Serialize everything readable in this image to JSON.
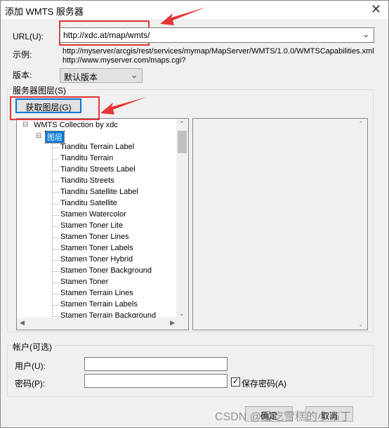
{
  "title": "添加 WMTS 服务器",
  "url": {
    "label": "URL(U):",
    "value": "http://xdc.at/map/wmts/"
  },
  "example": {
    "label": "示例:",
    "line1": "http://myserver/arcgis/rest/services/mymap/MapServer/WMTS/1.0.0/WMTSCapabilities.xml",
    "line2": "http://www.myserver.com/maps.cgi?"
  },
  "version": {
    "label": "版本:",
    "value": "默认版本"
  },
  "layers": {
    "group_label": "服务器图层(S)",
    "get_button": "获取图层(G)",
    "root": "WMTS Collection by xdc",
    "folder": "图层",
    "items": [
      "Tianditu Terrain Label",
      "Tianditu Terrain",
      "Tianditu Streets Label",
      "Tianditu Streets",
      "Tianditu Satellite Label",
      "Tianditu Satellite",
      "Stamen Watercolor",
      "Stamen Toner Lite",
      "Stamen Toner Lines",
      "Stamen Toner Labels",
      "Stamen Toner Hybrid",
      "Stamen Toner Background",
      "Stamen Toner",
      "Stamen Terrain Lines",
      "Stamen Terrain Labels",
      "Stamen Terrain Background"
    ]
  },
  "account": {
    "group_label": "帐户(可选)",
    "user_label": "用户(U):",
    "user_value": "",
    "password_label": "密码(P):",
    "password_value": "",
    "save_password": "保存密码(A)",
    "save_checked": true
  },
  "buttons": {
    "ok": "确定",
    "cancel": "取消"
  },
  "watermark": "CSDN @爱吃雪糕的小布丁",
  "colors": {
    "annotation": "#e53535",
    "focus": "#0078d7"
  }
}
